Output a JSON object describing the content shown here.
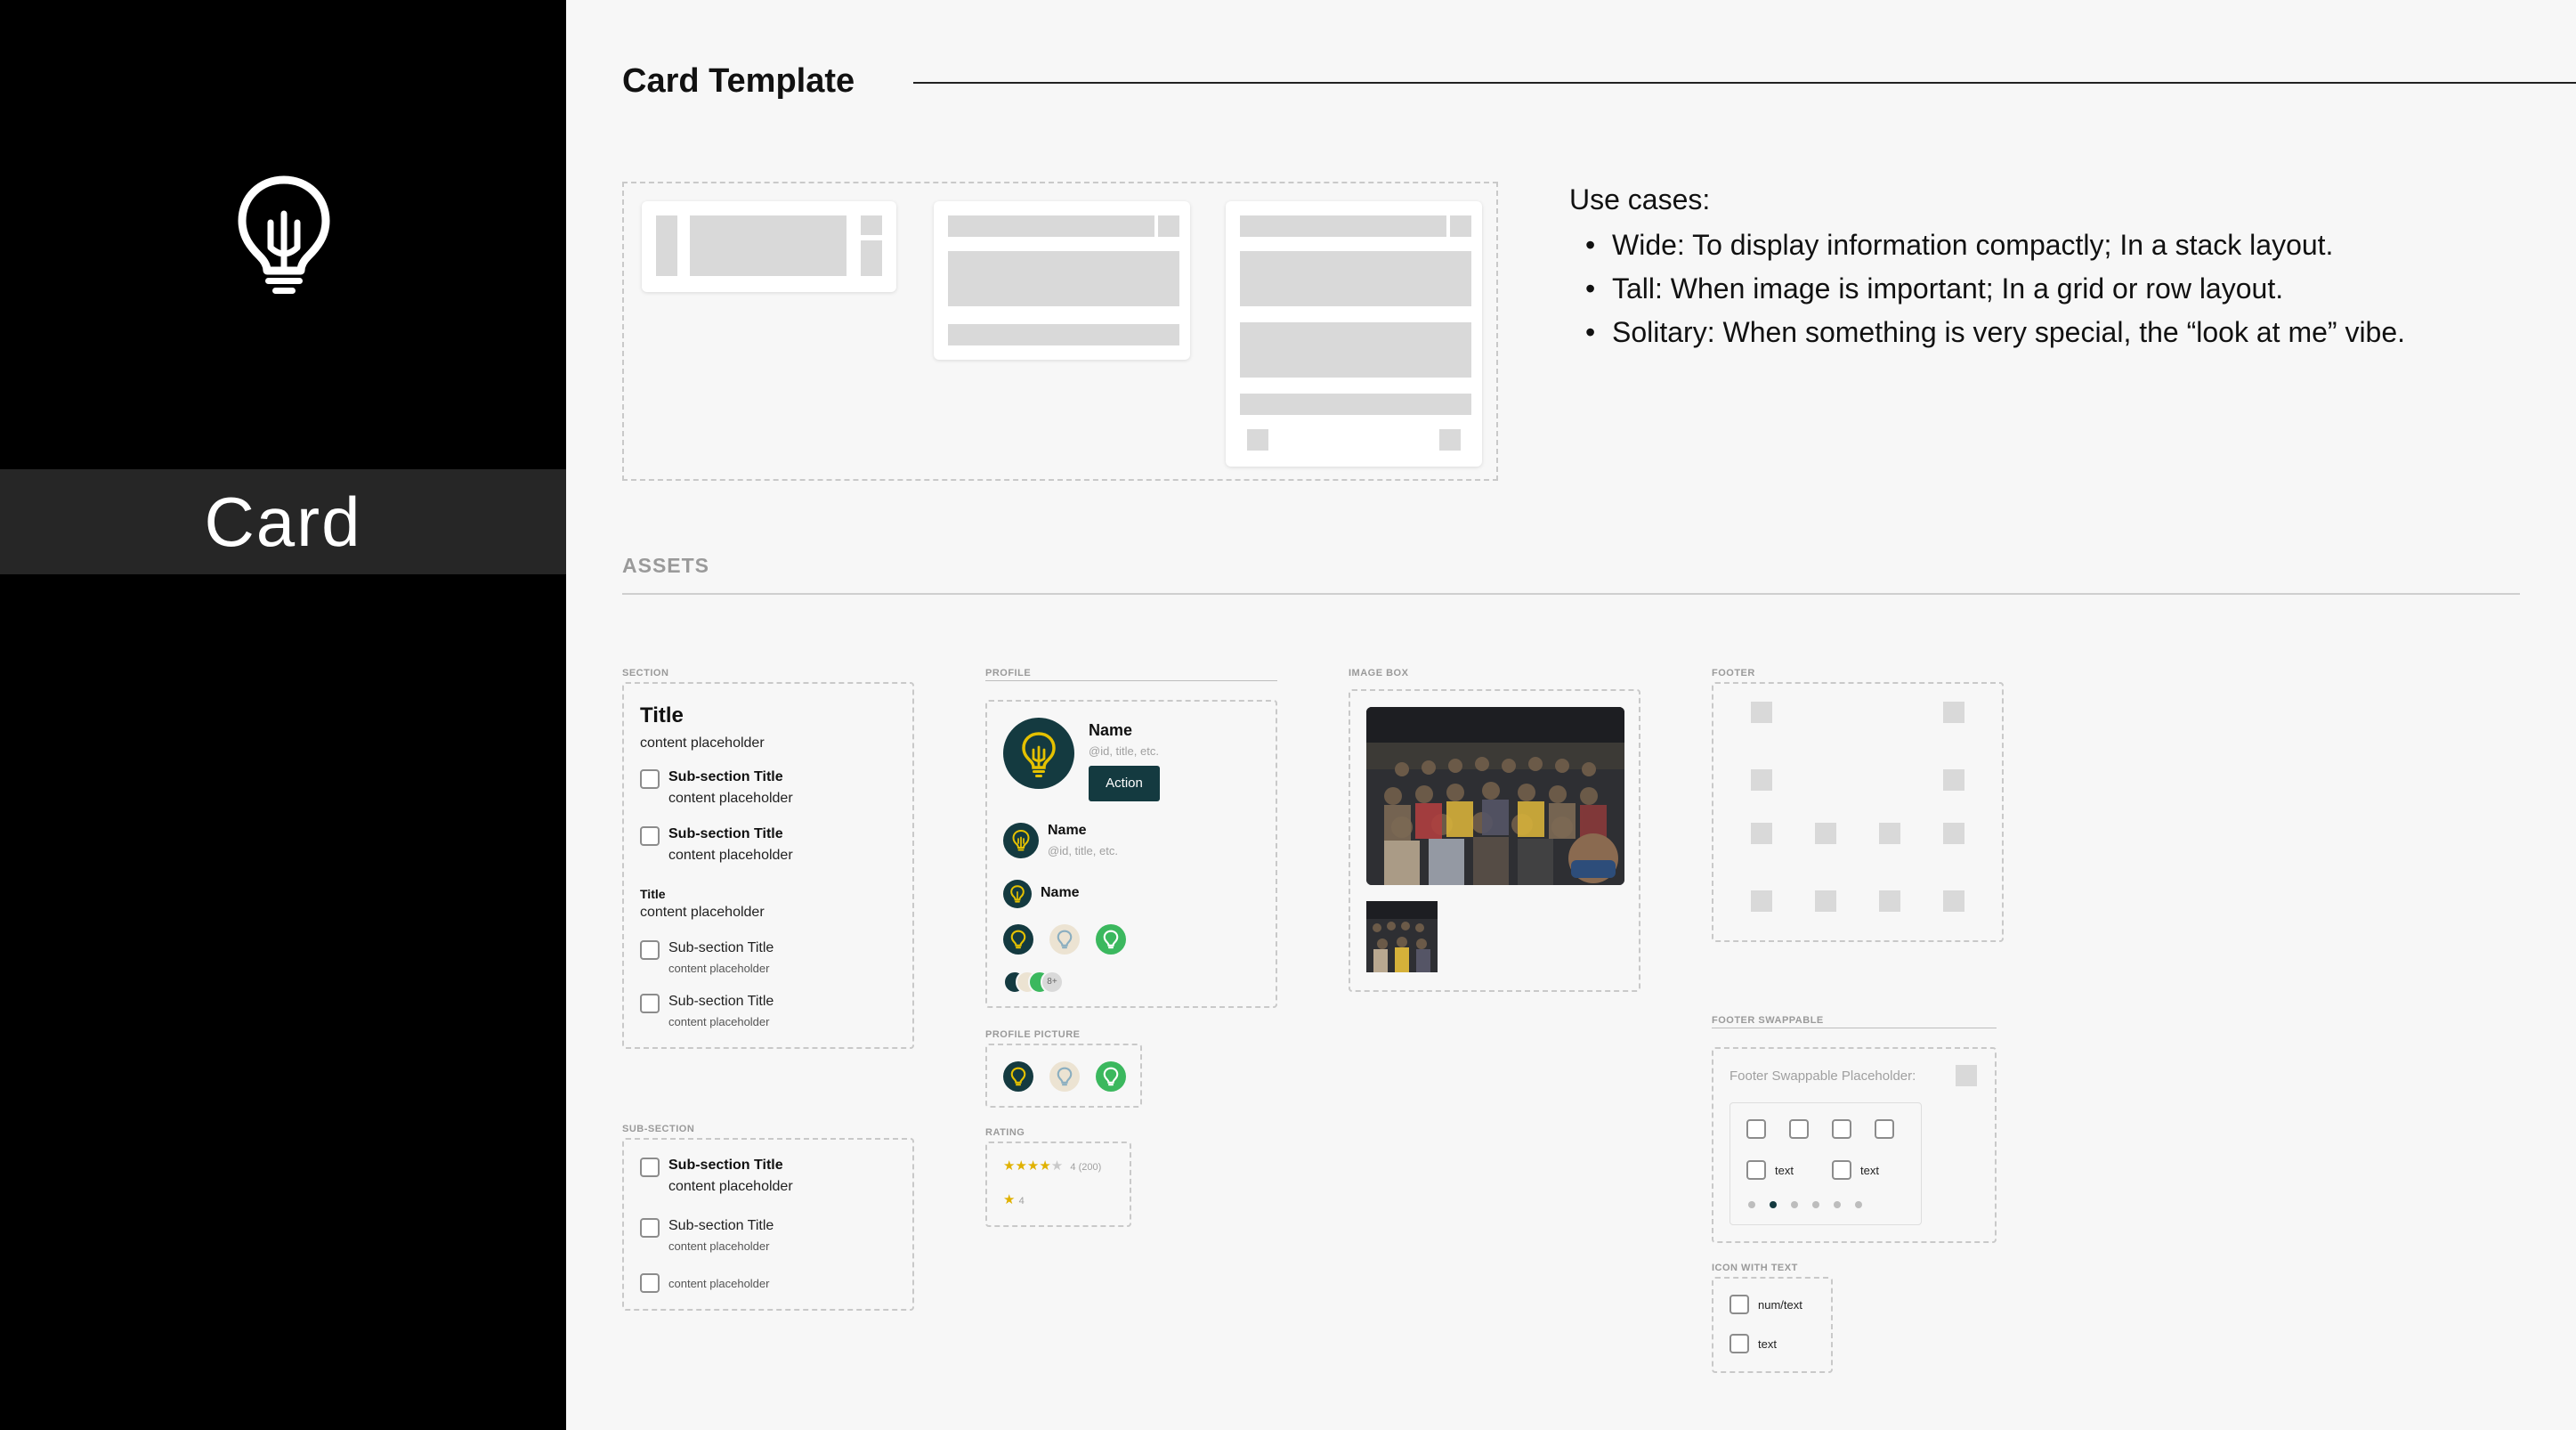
{
  "sidebar": {
    "title": "Card",
    "logo_icon": "lightbulb-icon"
  },
  "header": {
    "title": "Card Template"
  },
  "use_cases": {
    "heading": "Use cases:",
    "items": [
      "Wide: To display information compactly; In a stack layout.",
      "Tall: When image is important; In a grid or row layout.",
      "Solitary: When something is very special, the “look at me” vibe."
    ]
  },
  "assets": {
    "heading": "ASSETS",
    "section": {
      "label": "SECTION",
      "title": "Title",
      "content": "content placeholder",
      "sub_bold": [
        {
          "title": "Sub-section Title",
          "content": "content placeholder"
        },
        {
          "title": "Sub-section Title",
          "content": "content placeholder"
        }
      ],
      "title_small": "Title",
      "content_small": "content placeholder",
      "sub_regular": [
        {
          "title": "Sub-section Title",
          "content": "content placeholder"
        },
        {
          "title": "Sub-section Title",
          "content": "content placeholder"
        }
      ]
    },
    "subsection": {
      "label": "SUB-SECTION",
      "bold": {
        "title": "Sub-section Title",
        "content": "content placeholder"
      },
      "regular": {
        "title": "Sub-section Title",
        "content": "content placeholder"
      },
      "content_only": "content placeholder"
    },
    "profile": {
      "label": "PROFILE",
      "large": {
        "name": "Name",
        "meta": "@id, title, etc.",
        "action": "Action"
      },
      "medium": {
        "name": "Name",
        "meta": "@id, title, etc."
      },
      "small": {
        "name": "Name"
      },
      "stack_overflow": "8+"
    },
    "profile_picture": {
      "label": "PROFILE PICTURE"
    },
    "rating": {
      "label": "RATING",
      "stars_full": "★★★★",
      "star_empty": "★",
      "count": "4 (200)",
      "single_star": "★",
      "single_value": "4",
      "star_color": "#e0b100"
    },
    "image_box": {
      "label": "IMAGE BOX"
    },
    "footer": {
      "label": "FOOTER"
    },
    "footer_swappable": {
      "label": "FOOTER SWAPPABLE",
      "placeholder": "Footer Swappable Placeholder:",
      "text_a": "text",
      "text_b": "text"
    },
    "icon_with_text": {
      "label": "ICON WITH TEXT",
      "item_a": "num/text",
      "item_b": "text"
    }
  },
  "colors": {
    "brand_dark": "#143a40",
    "bulb_yellow": "#e5c100",
    "accent_green": "#3bb85e",
    "avatar_beige": "#ece3d2",
    "bulb_blue": "#8aaec0"
  }
}
